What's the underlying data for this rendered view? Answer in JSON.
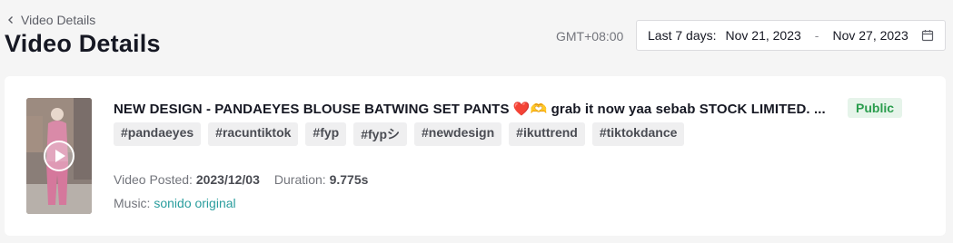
{
  "breadcrumb": {
    "label": "Video Details",
    "icon": "chevron-left-icon"
  },
  "page_title": "Video Details",
  "timezone": "GMT+08:00",
  "date_range": {
    "preset": "Last 7 days:",
    "start": "Nov 21, 2023",
    "separator": "-",
    "end": "Nov 27, 2023",
    "icon": "calendar-icon"
  },
  "video": {
    "title": "NEW DESIGN - PANDAEYES BLOUSE BATWING SET PANTS ❤️🫶 grab it now yaa sebab STOCK LIMITED. ...",
    "visibility": "Public",
    "tags": [
      "#pandaeyes",
      "#racuntiktok",
      "#fyp",
      "#fypシ",
      "#newdesign",
      "#ikuttrend",
      "#tiktokdance"
    ],
    "posted_label": "Video Posted:",
    "posted_value": "2023/12/03",
    "duration_label": "Duration:",
    "duration_value": "9.775s",
    "music_label": "Music:",
    "music_value": "sonido original",
    "thumbnail_icon": "play-icon"
  },
  "colors": {
    "page_bg": "#f5f5f5",
    "card_bg": "#ffffff",
    "badge_bg": "#e6f4ea",
    "badge_text": "#2a9d4d",
    "link": "#2a9d9d",
    "tag_bg": "#efeff0"
  }
}
